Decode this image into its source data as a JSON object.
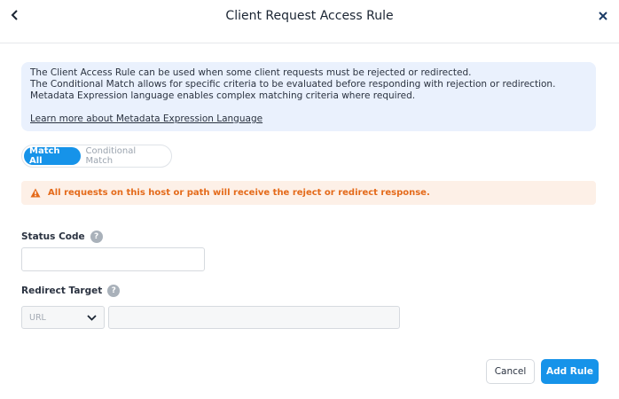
{
  "header": {
    "title": "Client Request Access Rule"
  },
  "info": {
    "line1": "The Client Access Rule can be used when some client requests must be rejected or redirected.",
    "line2": "The Conditional Match allows for specific criteria to be evaluated before responding with rejection or redirection.",
    "line3": "Metadata Expression language enables complex matching criteria where required.",
    "link": "Learn more about Metadata Expression Language"
  },
  "match_toggle": {
    "options": [
      "Match All",
      "Conditional Match"
    ],
    "selected": "Match All"
  },
  "warning": {
    "text": "All requests on this host or path will receive the reject or redirect response.",
    "color": "#e46a1a"
  },
  "status_code": {
    "label": "Status Code",
    "value": ""
  },
  "redirect_target": {
    "label": "Redirect Target",
    "type_selected": "URL",
    "value": ""
  },
  "footer": {
    "cancel": "Cancel",
    "add": "Add Rule"
  },
  "colors": {
    "accent": "#1693e9",
    "info_bg": "#eaf1fd",
    "warning_bg": "#fdf0e7"
  }
}
